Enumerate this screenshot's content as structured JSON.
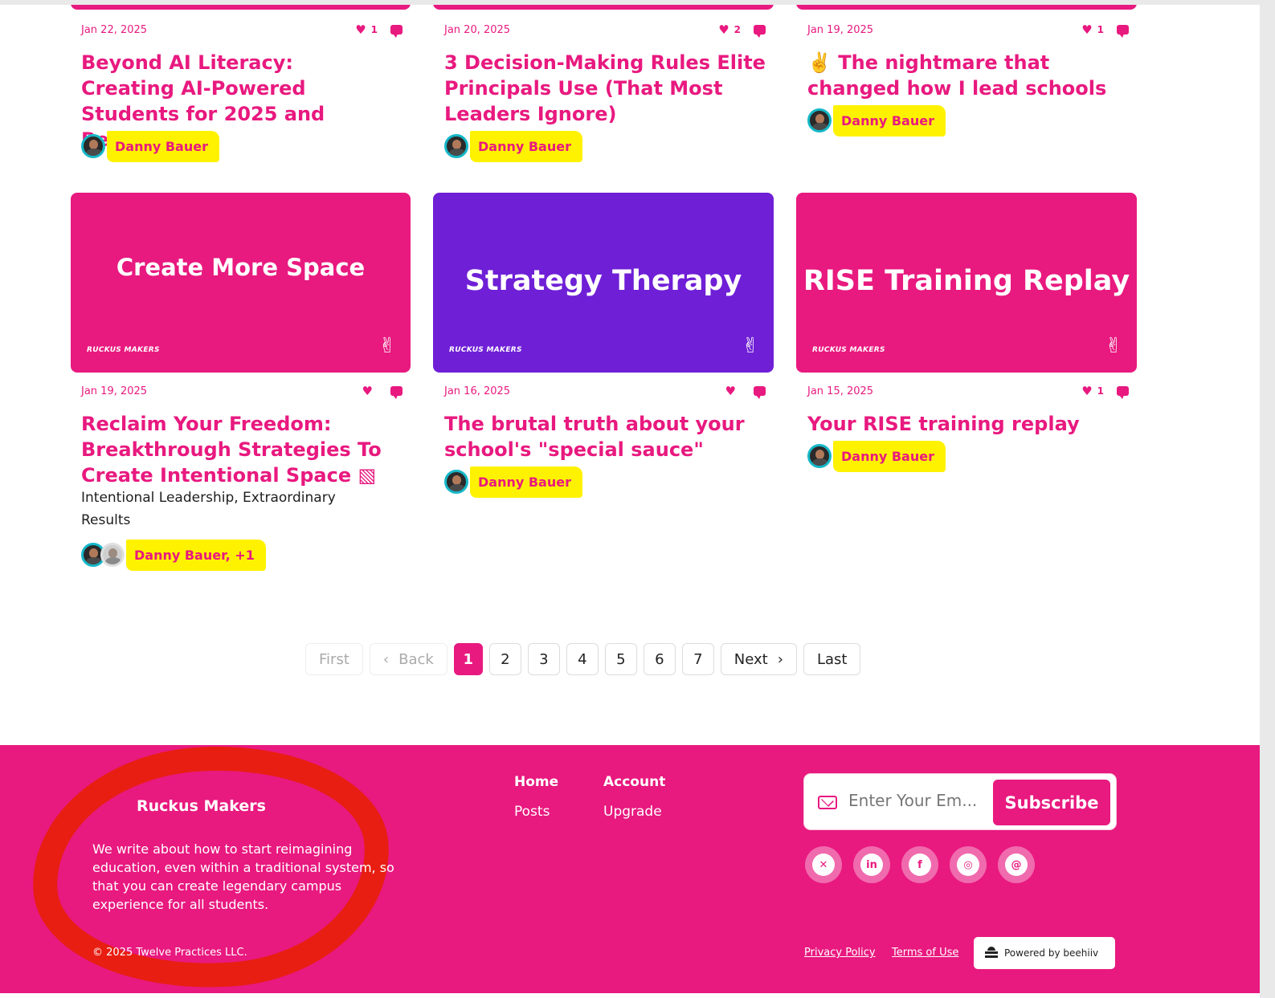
{
  "colors": {
    "brand_pink": "#e8197f",
    "purple": "#6f1fd6",
    "highlight": "#fff200",
    "scribble_red": "#e81e12"
  },
  "row1": [
    {
      "date": "Jan 22, 2025",
      "likes": "1",
      "title": "Beyond AI Literacy: Creating AI-Powered Students for 2025 and Beyond",
      "author": "Danny Bauer"
    },
    {
      "date": "Jan 20, 2025",
      "likes": "2",
      "title": "3 Decision-Making Rules Elite Principals Use (That Most Leaders Ignore)",
      "author": "Danny Bauer"
    },
    {
      "date": "Jan 19, 2025",
      "likes": "1",
      "title": "✌️ The nightmare that changed how I lead schools",
      "author": "Danny Bauer"
    }
  ],
  "row2": [
    {
      "thumb_title": "Create More Space",
      "thumb_color": "#e8197f",
      "date": "Jan 19, 2025",
      "likes": "",
      "title": "Reclaim Your Freedom: Breakthrough Strategies To Create Intentional Space ▧",
      "subtitle": "Intentional Leadership, Extraordinary Results",
      "author": "Danny Bauer, +1"
    },
    {
      "thumb_title": "Strategy Therapy",
      "thumb_color": "#6f1fd6",
      "date": "Jan 16, 2025",
      "likes": "",
      "title": "The brutal truth about your school's \"special sauce\"",
      "author": "Danny Bauer"
    },
    {
      "thumb_title": "RISE Training Replay",
      "thumb_color": "#e8197f",
      "date": "Jan 15, 2025",
      "likes": "1",
      "title": "Your RISE training replay",
      "author": "Danny Bauer"
    }
  ],
  "thumb_brand": "RUCKUS MAKERS",
  "icons": {
    "heart": "heart-icon",
    "comment": "comment-icon",
    "peace": "peace-sign-icon",
    "mail": "mail-icon"
  },
  "pagination": {
    "first": "First",
    "back": "Back",
    "pages": [
      "1",
      "2",
      "3",
      "4",
      "5",
      "6",
      "7"
    ],
    "current": "1",
    "next": "Next",
    "last": "Last"
  },
  "footer": {
    "brand": "Ruckus Makers",
    "description": "We write about how to start reimagining education, even within a traditional system, so that you can create legendary campus experience for all students.",
    "copyright": "© 2025 Twelve Practices LLC.",
    "nav": {
      "home": "Home",
      "posts": "Posts",
      "account": "Account",
      "upgrade": "Upgrade"
    },
    "subscribe": {
      "placeholder": "Enter Your Em...",
      "button": "Subscribe"
    },
    "social": [
      "x-icon",
      "linkedin-icon",
      "facebook-icon",
      "instagram-icon",
      "threads-icon"
    ],
    "privacy": "Privacy Policy",
    "terms": "Terms of Use",
    "powered": "Powered by beehiiv"
  }
}
